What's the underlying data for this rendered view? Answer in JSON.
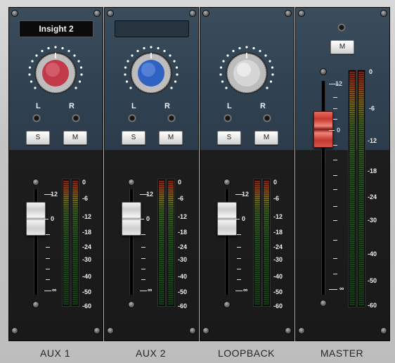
{
  "mixer": {
    "strips": [
      {
        "id": "aux1",
        "label": "AUX 1",
        "insert_name": "Insight 2",
        "knob_color": "#c23a4a",
        "pan_left_label": "L",
        "pan_right_label": "R",
        "solo_label": "S",
        "mute_label": "M",
        "fader_scale": [
          "12",
          "0",
          "∞"
        ],
        "meter_scale": [
          "0",
          "-6",
          "-12",
          "-18",
          "-24",
          "-30",
          "-40",
          "-50",
          "-60"
        ]
      },
      {
        "id": "aux2",
        "label": "AUX 2",
        "insert_name": "",
        "knob_color": "#2f62c2",
        "pan_left_label": "L",
        "pan_right_label": "R",
        "solo_label": "S",
        "mute_label": "M",
        "fader_scale": [
          "12",
          "0",
          "∞"
        ],
        "meter_scale": [
          "0",
          "-6",
          "-12",
          "-18",
          "-24",
          "-30",
          "-40",
          "-50",
          "-60"
        ]
      },
      {
        "id": "loopback",
        "label": "LOOPBACK",
        "knob_color": "#d6d6d6",
        "pan_left_label": "L",
        "pan_right_label": "R",
        "solo_label": "S",
        "mute_label": "M",
        "fader_scale": [
          "12",
          "0",
          "∞"
        ],
        "meter_scale": [
          "0",
          "-6",
          "-12",
          "-18",
          "-24",
          "-30",
          "-40",
          "-50",
          "-60"
        ]
      },
      {
        "id": "master",
        "label": "MASTER",
        "mute_label": "M",
        "fader_scale": [
          "12",
          "0",
          "∞"
        ],
        "meter_scale": [
          "0",
          "-6",
          "-12",
          "-18",
          "-24",
          "-30",
          "-40",
          "-50",
          "-60"
        ],
        "fader_cap_color": "#d23b30"
      }
    ]
  }
}
